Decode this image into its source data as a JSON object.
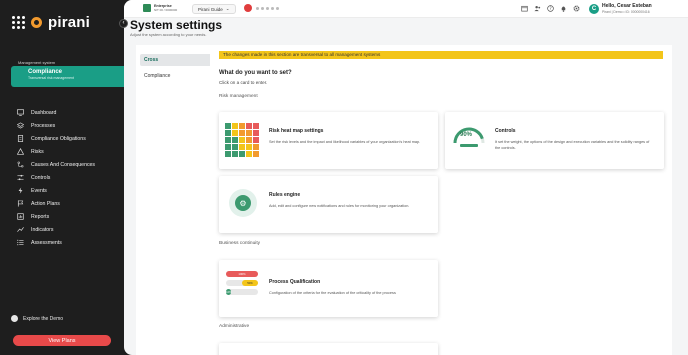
{
  "brand": {
    "name": "pirani",
    "accent": "#1a9e86",
    "logo_color": "#f29a2e"
  },
  "sidebar": {
    "section_label": "Management system",
    "module": {
      "name": "Compliance",
      "subtitle": "Transversal risk management"
    },
    "items": [
      {
        "label": "Dashboard",
        "icon": "monitor-icon"
      },
      {
        "label": "Processes",
        "icon": "layers-icon"
      },
      {
        "label": "Compliance Obligations",
        "icon": "document-icon"
      },
      {
        "label": "Risks",
        "icon": "warning-icon"
      },
      {
        "label": "Causes And Consequences",
        "icon": "branch-icon"
      },
      {
        "label": "Controls",
        "icon": "sliders-icon"
      },
      {
        "label": "Events",
        "icon": "bolt-icon"
      },
      {
        "label": "Action Plans",
        "icon": "flag-icon"
      },
      {
        "label": "Reports",
        "icon": "report-icon"
      },
      {
        "label": "Indicators",
        "icon": "chart-icon"
      },
      {
        "label": "Assessments",
        "icon": "list-icon"
      }
    ],
    "explore_label": "Explore the Demo",
    "view_plans_label": "View Plans",
    "view_plans_color": "#e84a4a"
  },
  "topbar": {
    "company_name": "Enterprise",
    "company_nit": "NIT 00 / 0000000",
    "guide_label": "Pirani Guide",
    "icons": [
      "records-icon",
      "people-icon",
      "help-icon",
      "bell-icon",
      "gear-icon"
    ],
    "avatar_initial": "C",
    "greeting": "Hello, Cesar Esteban",
    "user_info": "Pirani | Demo • ID: 0000000416"
  },
  "page": {
    "title": "System settings",
    "subtitle": "Adjust the system according to your needs."
  },
  "tabs": [
    {
      "label": "Cross",
      "active": true
    },
    {
      "label": "Compliance",
      "active": false
    }
  ],
  "content": {
    "notice": "The changes made in this section are transversal to all management systems",
    "question": "What do you want to set?",
    "instruction": "Click on a card to enter.",
    "sections": {
      "risk": "Risk management",
      "business": "Business continuity",
      "admin": "Administrative"
    },
    "cards": {
      "heatmap": {
        "title": "Risk heat map settings",
        "desc": "Set the risk levels and the impact and likelihood variables of your organization's heat map."
      },
      "controls": {
        "title": "Controls",
        "desc": "It set the weight, the options of the design and execution variables and the solidity ranges of the controls.",
        "gauge_value": "90%",
        "gauge_fraction": 0.9
      },
      "rules": {
        "title": "Rules engine",
        "desc": "Add, edit and configure new notifications and rules for monitoring your organization."
      },
      "process": {
        "title": "Process Qualification",
        "desc": "Configuration of the criteria for the evaluation of the criticality of the process",
        "bars": [
          {
            "label": "100%",
            "fraction": 1.0,
            "color": "#e85a5a"
          },
          {
            "label": "50%",
            "fraction": 0.5,
            "color": "#f3c51a"
          },
          {
            "label": "10%",
            "fraction": 0.15,
            "color": "#3c9a6f"
          }
        ]
      }
    }
  },
  "heatmap_colors": [
    "#3c9a6f",
    "#f3c51a",
    "#f29a2e",
    "#e85a5a",
    "#e85a5a",
    "#3c9a6f",
    "#f3c51a",
    "#f29a2e",
    "#f29a2e",
    "#e85a5a",
    "#3c9a6f",
    "#3c9a6f",
    "#f3c51a",
    "#f29a2e",
    "#e85a5a",
    "#3c9a6f",
    "#3c9a6f",
    "#f3c51a",
    "#f3c51a",
    "#f29a2e",
    "#3c9a6f",
    "#3c9a6f",
    "#3c9a6f",
    "#f3c51a",
    "#f29a2e"
  ]
}
